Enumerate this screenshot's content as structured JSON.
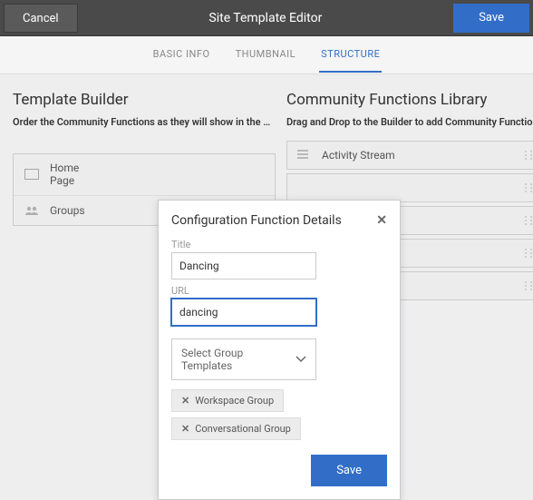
{
  "header": {
    "cancel_label": "Cancel",
    "title": "Site Template Editor",
    "save_label": "Save"
  },
  "tabs": {
    "basic_info": "BASIC INFO",
    "thumbnail": "THUMBNAIL",
    "structure": "STRUCTURE"
  },
  "builder": {
    "title": "Template Builder",
    "subtitle": "Order the Community Functions as they will show in the …",
    "items": [
      {
        "label_line1": "Home",
        "label_line2": "Page"
      },
      {
        "label_line1": "Groups",
        "label_line2": ""
      }
    ]
  },
  "library": {
    "title": "Community Functions Library",
    "subtitle": "Drag and Drop to the Builder to add Community Functions",
    "items": [
      {
        "label": "Activity Stream"
      },
      {
        "label": ""
      },
      {
        "label": ""
      },
      {
        "label": ""
      },
      {
        "label": ""
      }
    ]
  },
  "modal": {
    "title": "Configuration Function Details",
    "title_label": "Title",
    "title_value": "Dancing",
    "url_label": "URL",
    "url_value": "dancing",
    "select_label": "Select Group Templates",
    "chips": [
      {
        "label": "Workspace Group"
      },
      {
        "label": "Conversational Group"
      }
    ],
    "save_label": "Save"
  }
}
